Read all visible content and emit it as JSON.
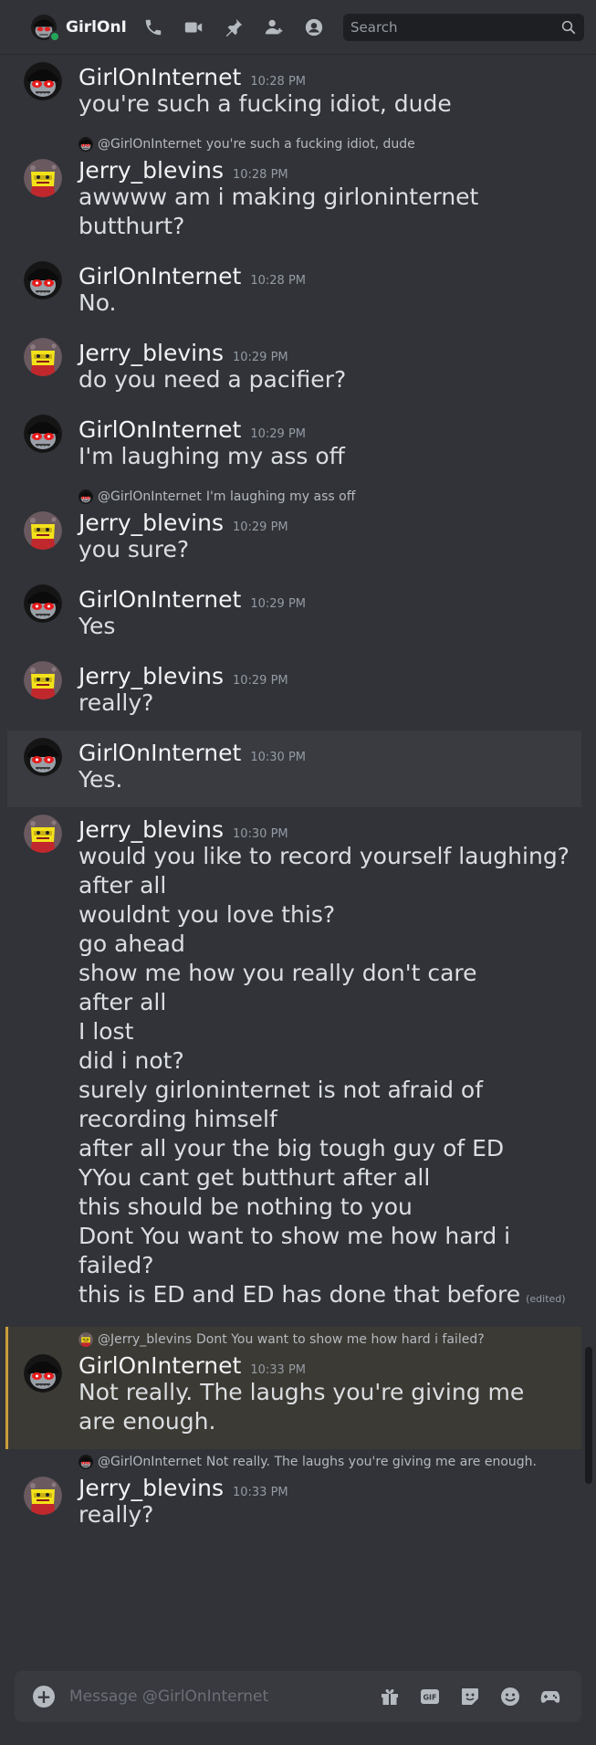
{
  "topbar": {
    "channel_name": "GirlOnInternet",
    "search_placeholder": "Search",
    "icons": [
      "voice-call-icon",
      "video-call-icon",
      "pinned-messages-icon",
      "add-friends-icon",
      "user-profile-icon",
      "search-icon"
    ]
  },
  "colors": {
    "background": "#313338",
    "mention_highlight": "#c89d3c",
    "online_status": "#23a55a"
  },
  "messages": [
    {
      "author": "GirlOnInternet",
      "avatar": "girl",
      "time": "10:28 PM",
      "lines": [
        "you're such a fucking idiot, dude"
      ]
    },
    {
      "author": "Jerry_blevins",
      "avatar": "jerry",
      "time": "10:28 PM",
      "reply": {
        "name": "@GirlOnInternet",
        "text": "you're such a fucking idiot, dude",
        "avatar": "girl"
      },
      "lines": [
        "awwww am i making girloninternet butthurt?"
      ]
    },
    {
      "author": "GirlOnInternet",
      "avatar": "girl",
      "time": "10:28 PM",
      "lines": [
        "No."
      ]
    },
    {
      "author": "Jerry_blevins",
      "avatar": "jerry",
      "time": "10:29 PM",
      "lines": [
        "do you need a pacifier?"
      ]
    },
    {
      "author": "GirlOnInternet",
      "avatar": "girl",
      "time": "10:29 PM",
      "lines": [
        "I'm laughing my ass off"
      ]
    },
    {
      "author": "Jerry_blevins",
      "avatar": "jerry",
      "time": "10:29 PM",
      "reply": {
        "name": "@GirlOnInternet",
        "text": "I'm laughing my ass off",
        "avatar": "girl"
      },
      "lines": [
        "you sure?"
      ]
    },
    {
      "author": "GirlOnInternet",
      "avatar": "girl",
      "time": "10:29 PM",
      "lines": [
        "Yes"
      ]
    },
    {
      "author": "Jerry_blevins",
      "avatar": "jerry",
      "time": "10:29 PM",
      "lines": [
        "really?"
      ]
    },
    {
      "author": "GirlOnInternet",
      "avatar": "girl",
      "time": "10:30 PM",
      "lines": [
        "Yes."
      ],
      "highlight": true
    },
    {
      "author": "Jerry_blevins",
      "avatar": "jerry",
      "time": "10:30 PM",
      "lines": [
        "would you like to record yourself laughing?",
        "after all",
        "wouldnt you love this?",
        "go ahead",
        "show me how you really don't care",
        "after all",
        "I lost",
        "did i not?",
        "surely girloninternet is not afraid of recording himself",
        "after all your the big tough guy of ED",
        "YYou cant get butthurt after all",
        "this should be nothing to you",
        "Dont You want to show me how hard i failed?",
        "this is ED and ED has done that before"
      ],
      "edited_label": "(edited)"
    },
    {
      "author": "GirlOnInternet",
      "avatar": "girl",
      "time": "10:33 PM",
      "mention": true,
      "reply": {
        "name": "@Jerry_blevins",
        "text": "Dont You want to show me how hard i failed?",
        "avatar": "jerry"
      },
      "lines": [
        "Not really. The laughs you're giving me are enough."
      ]
    },
    {
      "author": "Jerry_blevins",
      "avatar": "jerry",
      "time": "10:33 PM",
      "reply": {
        "name": "@GirlOnInternet",
        "text": "Not really. The laughs you're giving me are enough.",
        "avatar": "girl"
      },
      "lines": [
        "really?"
      ]
    }
  ],
  "composer": {
    "placeholder": "Message @GirlOnInternet",
    "icons": [
      "add-attachment-icon",
      "gift-icon",
      "gif-icon",
      "sticker-icon",
      "emoji-icon",
      "activity-icon"
    ]
  }
}
